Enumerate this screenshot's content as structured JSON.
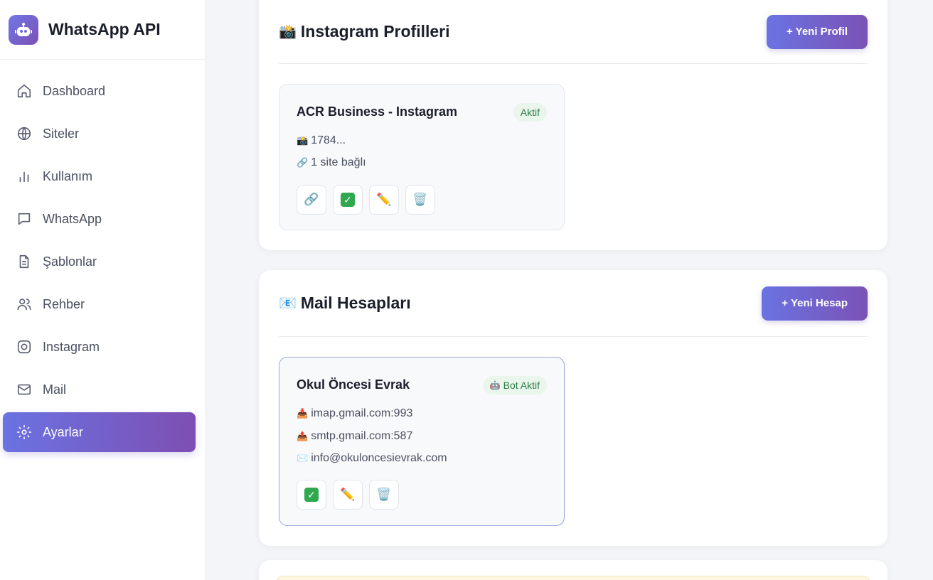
{
  "app": {
    "title": "WhatsApp API"
  },
  "sidebar": {
    "items": [
      {
        "label": "Dashboard",
        "icon": "home-icon"
      },
      {
        "label": "Siteler",
        "icon": "globe-icon"
      },
      {
        "label": "Kullanım",
        "icon": "bar-chart-icon"
      },
      {
        "label": "WhatsApp",
        "icon": "message-icon"
      },
      {
        "label": "Şablonlar",
        "icon": "document-icon"
      },
      {
        "label": "Rehber",
        "icon": "users-icon"
      },
      {
        "label": "Instagram",
        "icon": "instagram-icon"
      },
      {
        "label": "Mail",
        "icon": "mail-icon"
      },
      {
        "label": "Ayarlar",
        "icon": "gear-icon",
        "active": true
      }
    ]
  },
  "instagram": {
    "title_emoji": "📸",
    "title": "Instagram Profilleri",
    "new_button": "+ Yeni Profil",
    "profile": {
      "name": "ACR Business - Instagram",
      "status": "Aktif",
      "account_emoji": "📸",
      "account_id": "1784...",
      "link_emoji": "🔗",
      "sites": "1 site bağlı",
      "actions": [
        "🔗",
        "✓",
        "✏️",
        "🗑️"
      ]
    }
  },
  "mail": {
    "title_emoji": "📧",
    "title": "Mail Hesapları",
    "new_button": "+ Yeni Hesap",
    "account": {
      "name": "Okul Öncesi Evrak",
      "status_emoji": "🤖",
      "status": "Bot Aktif",
      "imap_emoji": "📥",
      "imap": "imap.gmail.com:993",
      "smtp_emoji": "📤",
      "smtp": "smtp.gmail.com:587",
      "email_emoji": "✉️",
      "email": "info@okuloncesievrak.com",
      "actions": [
        "✓",
        "✏️",
        "🗑️"
      ]
    }
  },
  "colors": {
    "accent_start": "#6a73e2",
    "accent_end": "#7b52b6",
    "status_bg": "#eaf6ec",
    "status_text": "#2e7d4a"
  }
}
